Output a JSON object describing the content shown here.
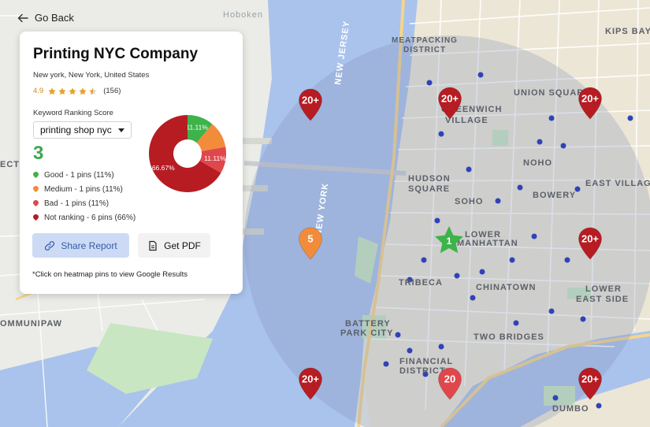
{
  "nav": {
    "back_label": "Go Back"
  },
  "business": {
    "name": "Printing NYC Company",
    "address": "New york, New York, United States",
    "rating": "4.9",
    "rating_value": 4.5,
    "review_count": "(156)"
  },
  "ranking": {
    "label": "Keyword Ranking Score",
    "keyword": "printing shop nyc",
    "score": "3",
    "legend": [
      {
        "label": "Good - 1 pins (11%)",
        "color": "#3db34a"
      },
      {
        "label": "Medium - 1 pins (11%)",
        "color": "#f28c3a"
      },
      {
        "label": "Bad - 1 pins (11%)",
        "color": "#e0474c"
      },
      {
        "label": "Not ranking - 6 pins (66%)",
        "color": "#b71c22"
      }
    ]
  },
  "chart_data": {
    "type": "pie",
    "slices": [
      {
        "label": "11.11%",
        "value": 11.11,
        "color": "#3db34a"
      },
      {
        "label": "",
        "value": 11.11,
        "color": "#f28c3a"
      },
      {
        "label": "11.11%",
        "value": 11.11,
        "color": "#e0474c"
      },
      {
        "label": "66.67%",
        "value": 66.67,
        "color": "#b71c22"
      }
    ]
  },
  "actions": {
    "share_label": "Share Report",
    "pdf_label": "Get PDF"
  },
  "note": "*Click on heatmap pins to view Google Results",
  "map_labels": [
    "Hoboken",
    "MEATPACKING",
    "DISTRICT",
    "KIPS BAY",
    "GREENWICH",
    "VILLAGE",
    "UNION SQUARE",
    "NOHO",
    "HUDSON",
    "SQUARE",
    "BOWERY",
    "EAST VILLAGE",
    "SOHO",
    "LOWER",
    "MANHATTAN",
    "TRIBECA",
    "CHINATOWN",
    "LOWER",
    "EAST SIDE",
    "BATTERY",
    "PARK CITY",
    "TWO BRIDGES",
    "FINANCIAL",
    "DISTRICT",
    "DUMBO",
    "OMMUNIPAW",
    "ECTIO",
    "NEW JERSEY",
    "NEW YORK"
  ],
  "pins": [
    {
      "label": "20+",
      "rank": "not-ranking",
      "color": "#b71c22"
    },
    {
      "label": "20+",
      "rank": "not-ranking",
      "color": "#b71c22"
    },
    {
      "label": "20+",
      "rank": "not-ranking",
      "color": "#b71c22"
    },
    {
      "label": "5",
      "rank": "medium",
      "color": "#f28c3a"
    },
    {
      "label": "20+",
      "rank": "not-ranking",
      "color": "#b71c22"
    },
    {
      "label": "20+",
      "rank": "not-ranking",
      "color": "#b71c22"
    },
    {
      "label": "20",
      "rank": "bad",
      "color": "#e0474c"
    },
    {
      "label": "20+",
      "rank": "not-ranking",
      "color": "#b71c22"
    }
  ],
  "center_pin": {
    "label": "1",
    "color": "#3db34a"
  },
  "colors": {
    "water": "#a9c3ec",
    "land": "#e9ebe6",
    "park": "#c8e6c2",
    "radius": "#9aa8c8"
  }
}
